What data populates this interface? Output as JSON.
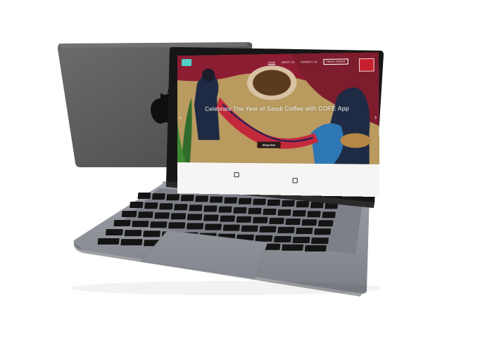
{
  "site": {
    "nav": {
      "items": [
        "HOME",
        "ABOUT US",
        "CONTACT US"
      ],
      "track_order": "TRACK ORDER",
      "user_label": ""
    },
    "hero": {
      "title": "Celebrate The Year of Saudi Coffee with COFE App",
      "cta": "Shop Now"
    },
    "info": [
      {
        "title": "",
        "subtitle": ""
      },
      {
        "title": "",
        "subtitle": ""
      }
    ]
  },
  "device": {
    "brand_label": "MacBook"
  },
  "colors": {
    "hero_red": "#8d1d32",
    "hero_sand": "#b99a5f",
    "logo_teal": "#4fd1c5",
    "button_dark": "#2a1b17",
    "laptop_gray": "#8a8d93"
  }
}
